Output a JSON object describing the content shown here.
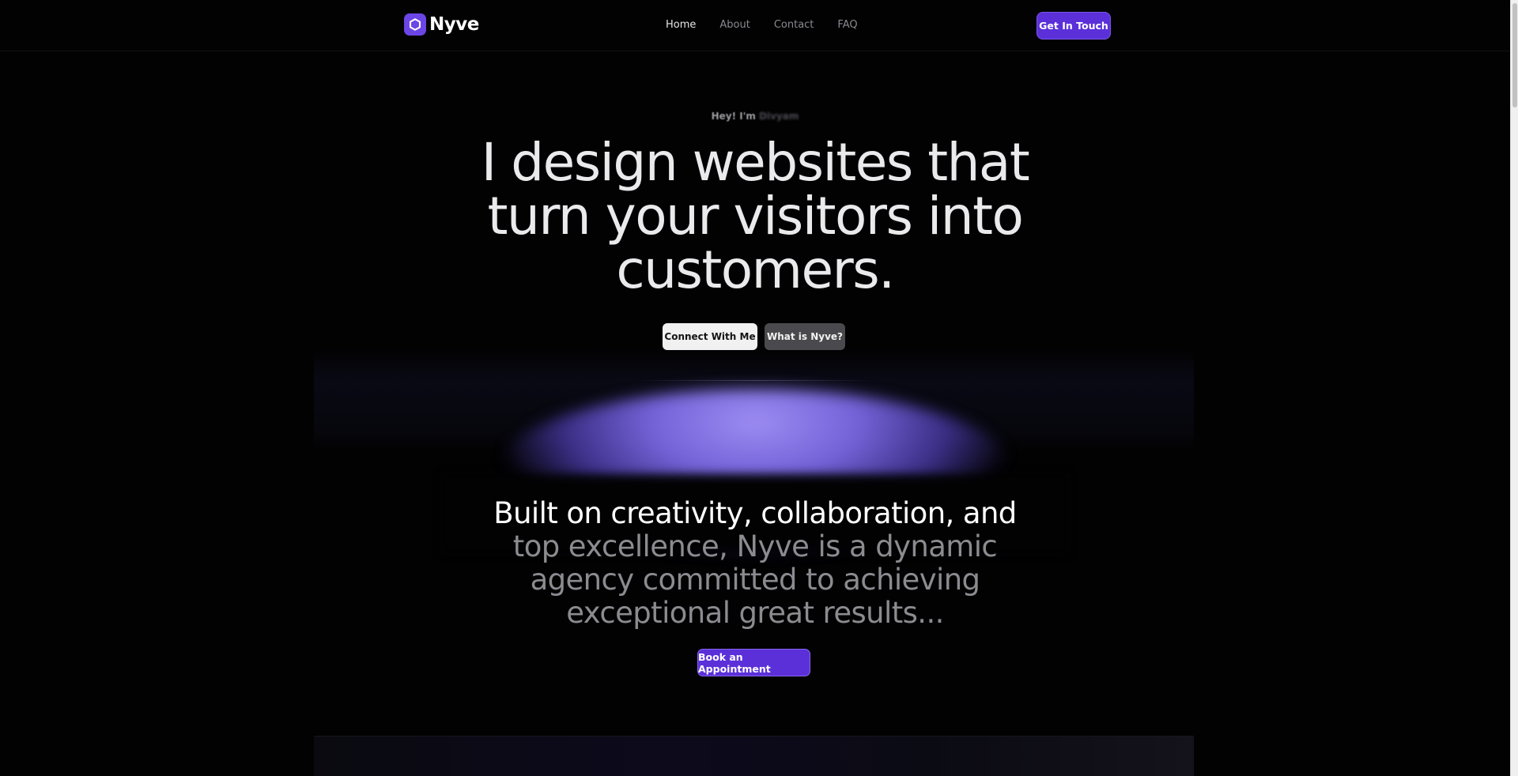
{
  "brand": {
    "name": "Nyve",
    "accent": "#5b30d9"
  },
  "nav": {
    "items": [
      {
        "label": "Home",
        "active": true
      },
      {
        "label": "About",
        "active": false
      },
      {
        "label": "Contact",
        "active": false
      },
      {
        "label": "FAQ",
        "active": false
      }
    ],
    "cta": "Get In Touch"
  },
  "hero": {
    "eyebrow_prefix": "Hey! I'm",
    "eyebrow_name": "Divyam",
    "title": "I design websites that turn your visitors into customers.",
    "primary_button": "Connect With Me",
    "secondary_button": "What is Nyve?"
  },
  "about": {
    "text_bright": "Built on creativity, collaboration, and",
    "text_dim": "top excellence, Nyve is a dynamic agency committed to achieving exceptional great results...",
    "cta": "Book an Appointment"
  }
}
